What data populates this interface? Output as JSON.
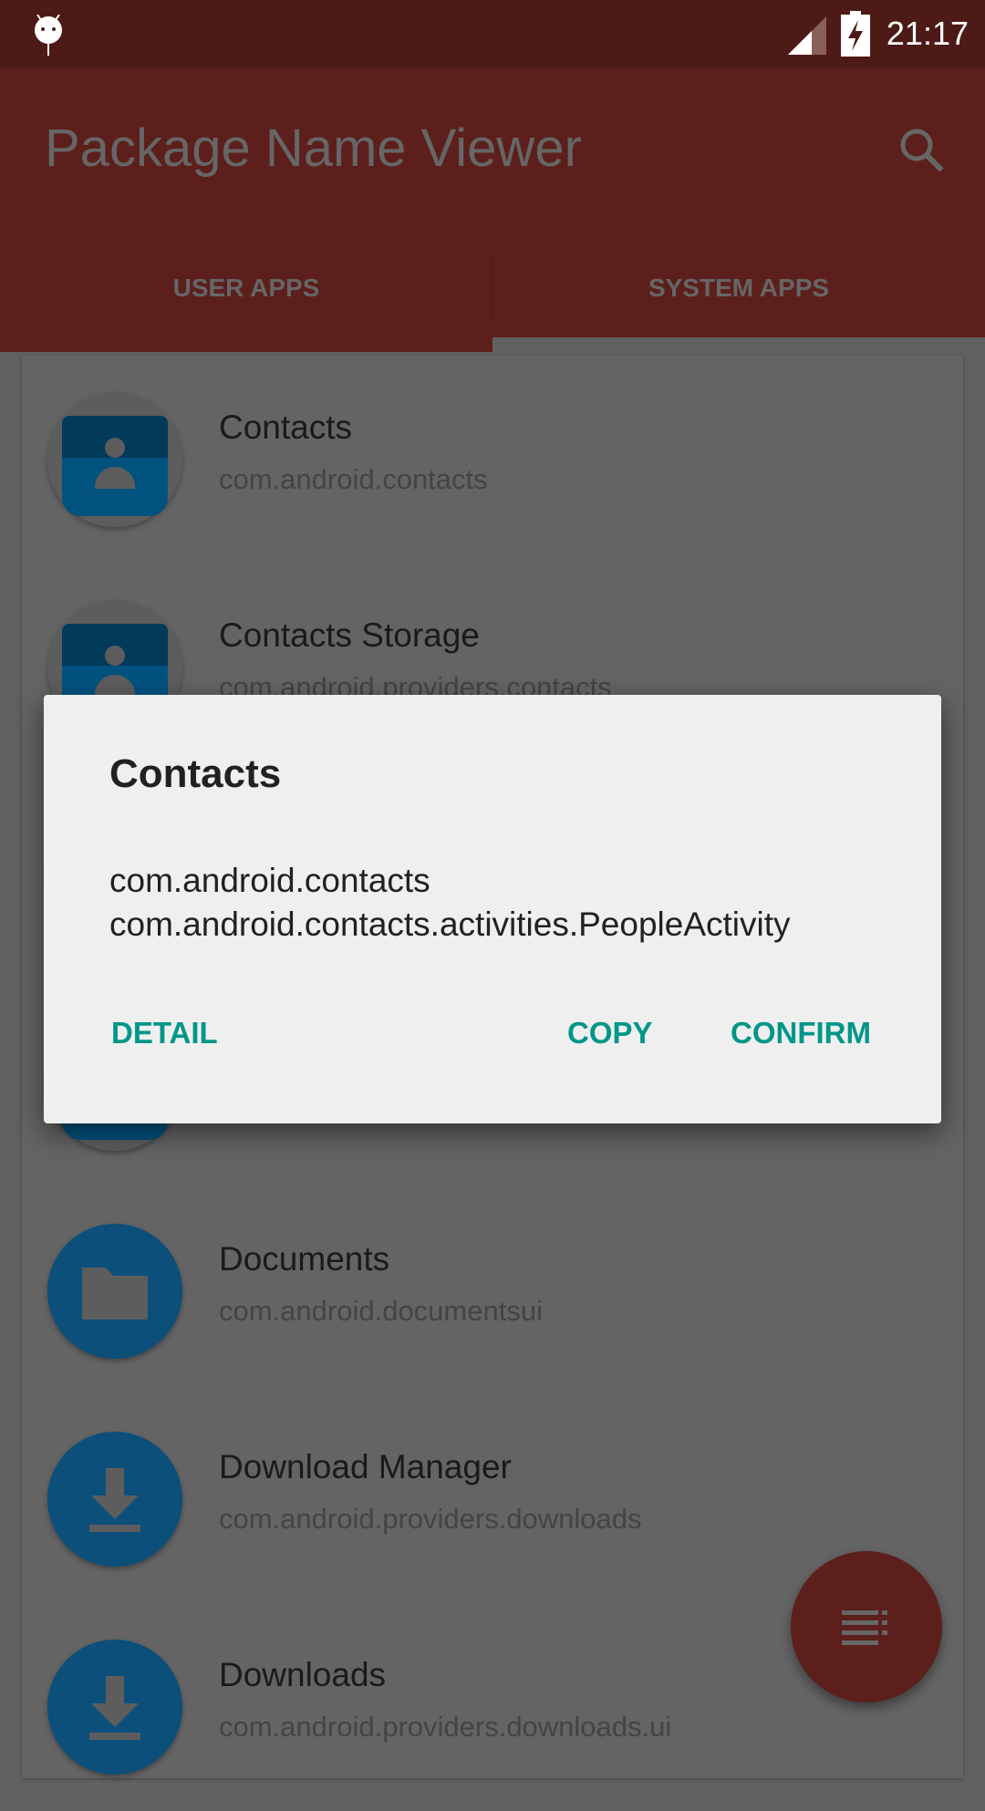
{
  "status_bar": {
    "time": "21:17",
    "icons": [
      "android-debug-icon",
      "signal-icon",
      "battery-charging-icon"
    ]
  },
  "toolbar": {
    "title": "Package Name Viewer",
    "search_icon": "search-icon"
  },
  "tabs": [
    {
      "label": "USER APPS",
      "selected": true
    },
    {
      "label": "SYSTEM APPS",
      "selected": false
    }
  ],
  "apps": [
    {
      "name": "Contacts",
      "package": "com.android.contacts",
      "icon": "contacts-icon"
    },
    {
      "name": "Contacts Storage",
      "package": "com.android.providers.contacts",
      "icon": "contacts-icon"
    },
    {
      "name": "Documents",
      "package": "com.android.documentsui",
      "icon": "folder-icon"
    },
    {
      "name": "Download Manager",
      "package": "com.android.providers.downloads",
      "icon": "download-icon"
    },
    {
      "name": "Downloads",
      "package": "com.android.providers.downloads.ui",
      "icon": "download-icon"
    }
  ],
  "dialog": {
    "title": "Contacts",
    "line1": "com.android.contacts",
    "line2": "com.android.contacts.activities.PeopleActivity",
    "detail": "DETAIL",
    "copy": "COPY",
    "confirm": "CONFIRM"
  },
  "colors": {
    "primary": "#e64e44",
    "status_bar": "#4d1a17",
    "accent": "#009688"
  },
  "fab_icon": "sort-list-icon"
}
